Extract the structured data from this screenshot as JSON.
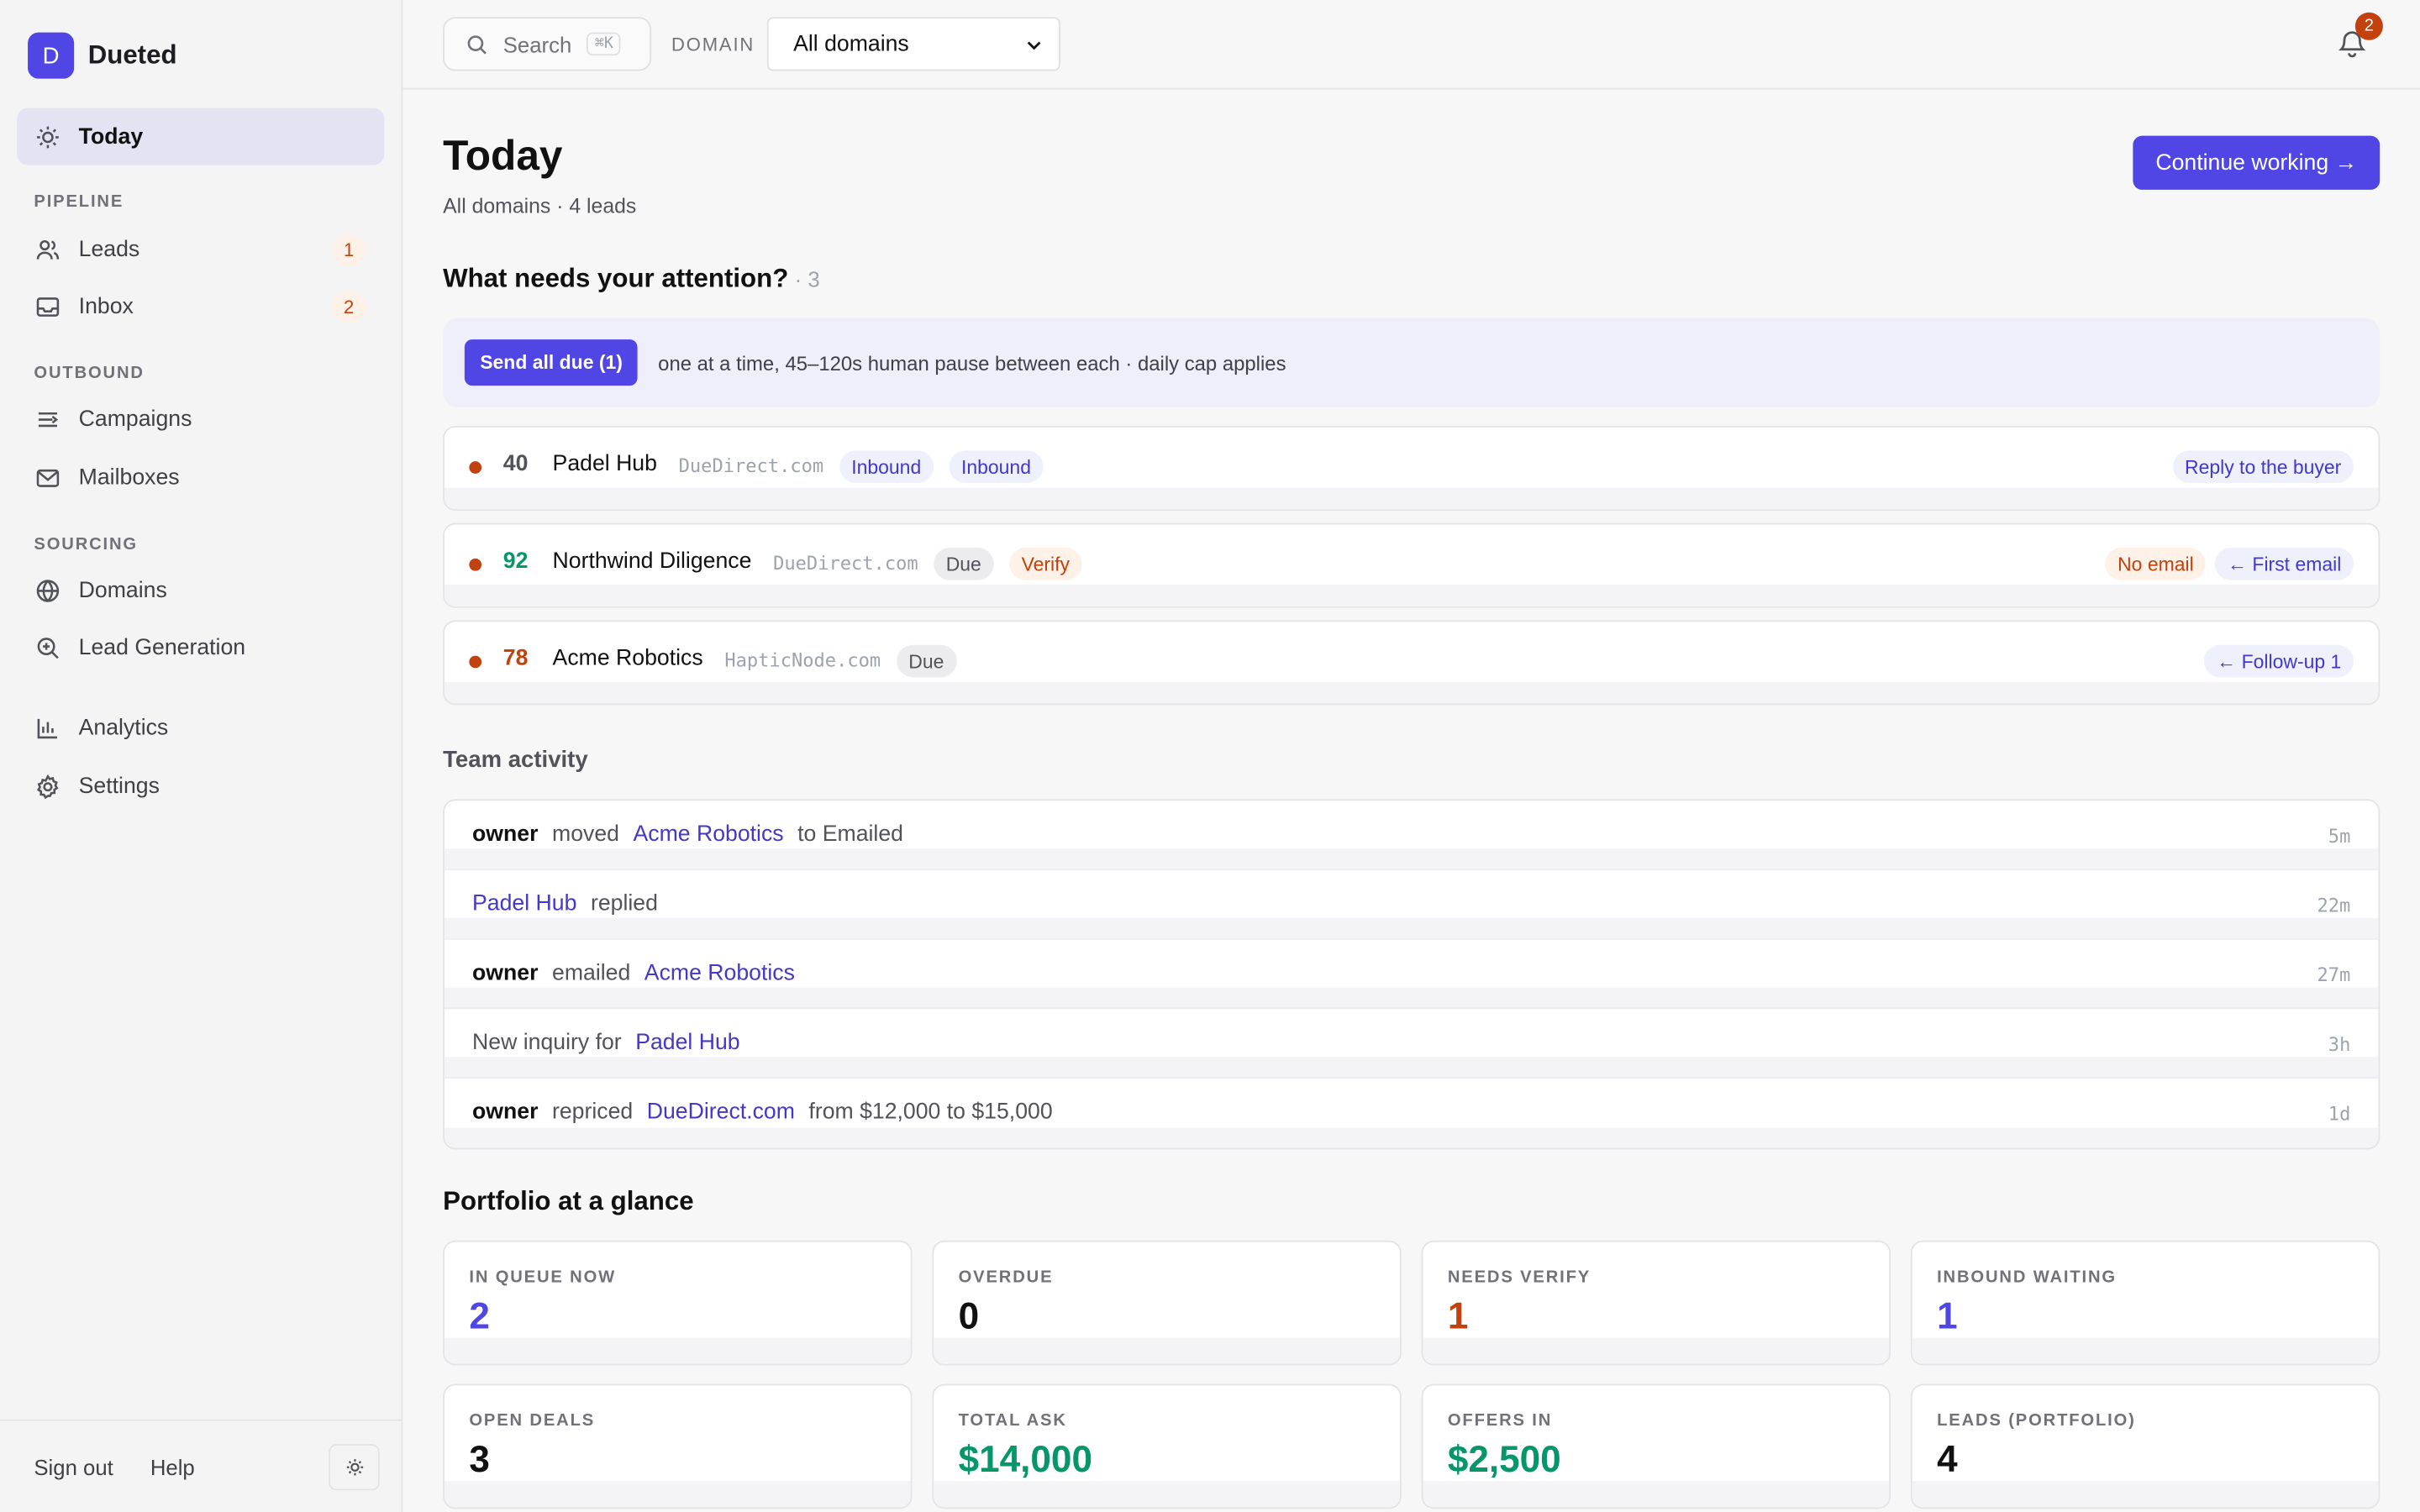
{
  "app": {
    "logo_letter": "D",
    "name": "Dueted"
  },
  "sidebar": {
    "today": "Today",
    "sections": {
      "pipeline": "PIPELINE",
      "outbound": "OUTBOUND",
      "sourcing": "SOURCING"
    },
    "leads": {
      "label": "Leads",
      "badge": "1"
    },
    "inbox": {
      "label": "Inbox",
      "badge": "2"
    },
    "campaigns": "Campaigns",
    "mailboxes": "Mailboxes",
    "domains": "Domains",
    "lead_generation": "Lead Generation",
    "analytics": "Analytics",
    "settings": "Settings",
    "footer": {
      "sign_out": "Sign out",
      "help": "Help"
    }
  },
  "topbar": {
    "search_placeholder": "Search",
    "search_shortcut": "⌘K",
    "domain_label": "DOMAIN",
    "domain_value": "All domains",
    "notifications": "2"
  },
  "page": {
    "title": "Today",
    "subtitle": "All domains · 4 leads",
    "cta": "Continue working →"
  },
  "attention": {
    "title": "What needs your attention?",
    "count": "· 3",
    "send_all": "Send all due (1)",
    "note": "one at a time, 45–120s human pause between each · daily cap applies",
    "leads": [
      {
        "score": "40",
        "score_color": "#52525b",
        "name": "Padel Hub",
        "domain": "DueDirect.com",
        "tag1": "Inbound",
        "tag2": "Inbound",
        "action": "Reply to the buyer"
      },
      {
        "score": "92",
        "score_color": "#059669",
        "name": "Northwind Diligence",
        "domain": "DueDirect.com",
        "tag1": "Due",
        "tag2": "Verify",
        "flag": "No email",
        "action": "← First email"
      },
      {
        "score": "78",
        "score_color": "#c2410c",
        "name": "Acme Robotics",
        "domain": "HapticNode.com",
        "tag1": "Due",
        "action": "← Follow-up 1"
      }
    ]
  },
  "activity": {
    "title": "Team activity",
    "rows": [
      {
        "who": "owner",
        "verb": "moved",
        "target": "Acme Robotics",
        "rest": "to Emailed",
        "time": "5m"
      },
      {
        "target": "Padel Hub",
        "verb": "replied",
        "time": "22m"
      },
      {
        "who": "owner",
        "verb": "emailed",
        "target": "Acme Robotics",
        "time": "27m"
      },
      {
        "verb": "New inquiry for",
        "target": "Padel Hub",
        "time": "3h"
      },
      {
        "who": "owner",
        "verb": "repriced",
        "target": "DueDirect.com",
        "rest": "from $12,000 to $15,000",
        "time": "1d"
      }
    ]
  },
  "portfolio": {
    "title": "Portfolio at a glance",
    "stats": [
      {
        "label": "IN QUEUE NOW",
        "value": "2",
        "color": "#4f46e5"
      },
      {
        "label": "OVERDUE",
        "value": "0",
        "color": "#111111"
      },
      {
        "label": "NEEDS VERIFY",
        "value": "1",
        "color": "#c2410c"
      },
      {
        "label": "INBOUND WAITING",
        "value": "1",
        "color": "#4f46e5"
      },
      {
        "label": "OPEN DEALS",
        "value": "3",
        "color": "#111111"
      },
      {
        "label": "TOTAL ASK",
        "value": "$14,000",
        "color": "#059669"
      },
      {
        "label": "OFFERS IN",
        "value": "$2,500",
        "color": "#059669"
      },
      {
        "label": "LEADS (PORTFOLIO)",
        "value": "4",
        "color": "#111111"
      }
    ]
  },
  "colors": {
    "accent": "#4f46e5",
    "warning": "#c2410c",
    "success": "#059669"
  }
}
